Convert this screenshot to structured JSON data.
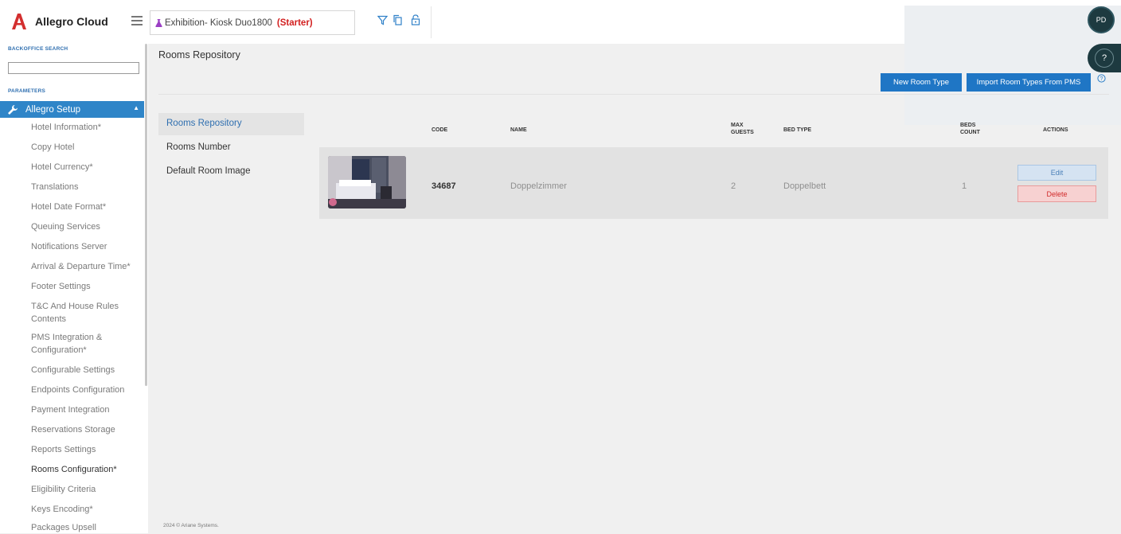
{
  "app": {
    "title": "Allegro Cloud",
    "brand_color": "#d32f2f"
  },
  "hotel": {
    "name": "Exhibition- Kiosk Duo1800",
    "plan": "(Starter)"
  },
  "toolbar": {
    "icons": [
      "filter-icon",
      "copy-icon",
      "lock-icon"
    ]
  },
  "user": {
    "initials": "PD",
    "help": "?"
  },
  "sidebar": {
    "search_label": "BACKOFFICE SEARCH",
    "params_label": "PARAMETERS",
    "section": "Allegro Setup",
    "items": [
      "Hotel Information*",
      "Copy Hotel",
      "Hotel Currency*",
      "Translations",
      "Hotel Date Format*",
      "Queuing Services",
      "Notifications Server",
      "Arrival & Departure Time*",
      "Footer Settings",
      "T&C And House Rules Contents",
      "PMS Integration & Configuration*",
      "Configurable Settings",
      "Endpoints Configuration",
      "Payment Integration",
      "Reservations Storage",
      "Reports Settings",
      "Rooms Configuration*",
      "Eligibility Criteria",
      "Keys Encoding*",
      "Packages Upsell"
    ]
  },
  "main": {
    "title": "Rooms Repository",
    "new_room_type": "New Room Type",
    "import_room_types": "Import Room Types From PMS",
    "subnav": [
      "Rooms Repository",
      "Rooms Number",
      "Default Room Image"
    ],
    "columns": {
      "code": "CODE",
      "name": "NAME",
      "max_guests_1": "MAX",
      "max_guests_2": "GUESTS",
      "bed_type": "BED TYPE",
      "beds_count_1": "BEDS",
      "beds_count_2": "COUNT",
      "actions": "ACTIONS"
    },
    "rows": [
      {
        "code": "34687",
        "name": "Doppelzimmer",
        "max_guests": "2",
        "bed_type": "Doppelbett",
        "beds_count": "1",
        "edit": "Edit",
        "delete": "Delete"
      }
    ]
  },
  "footer": "2024 © Ariane Systems."
}
